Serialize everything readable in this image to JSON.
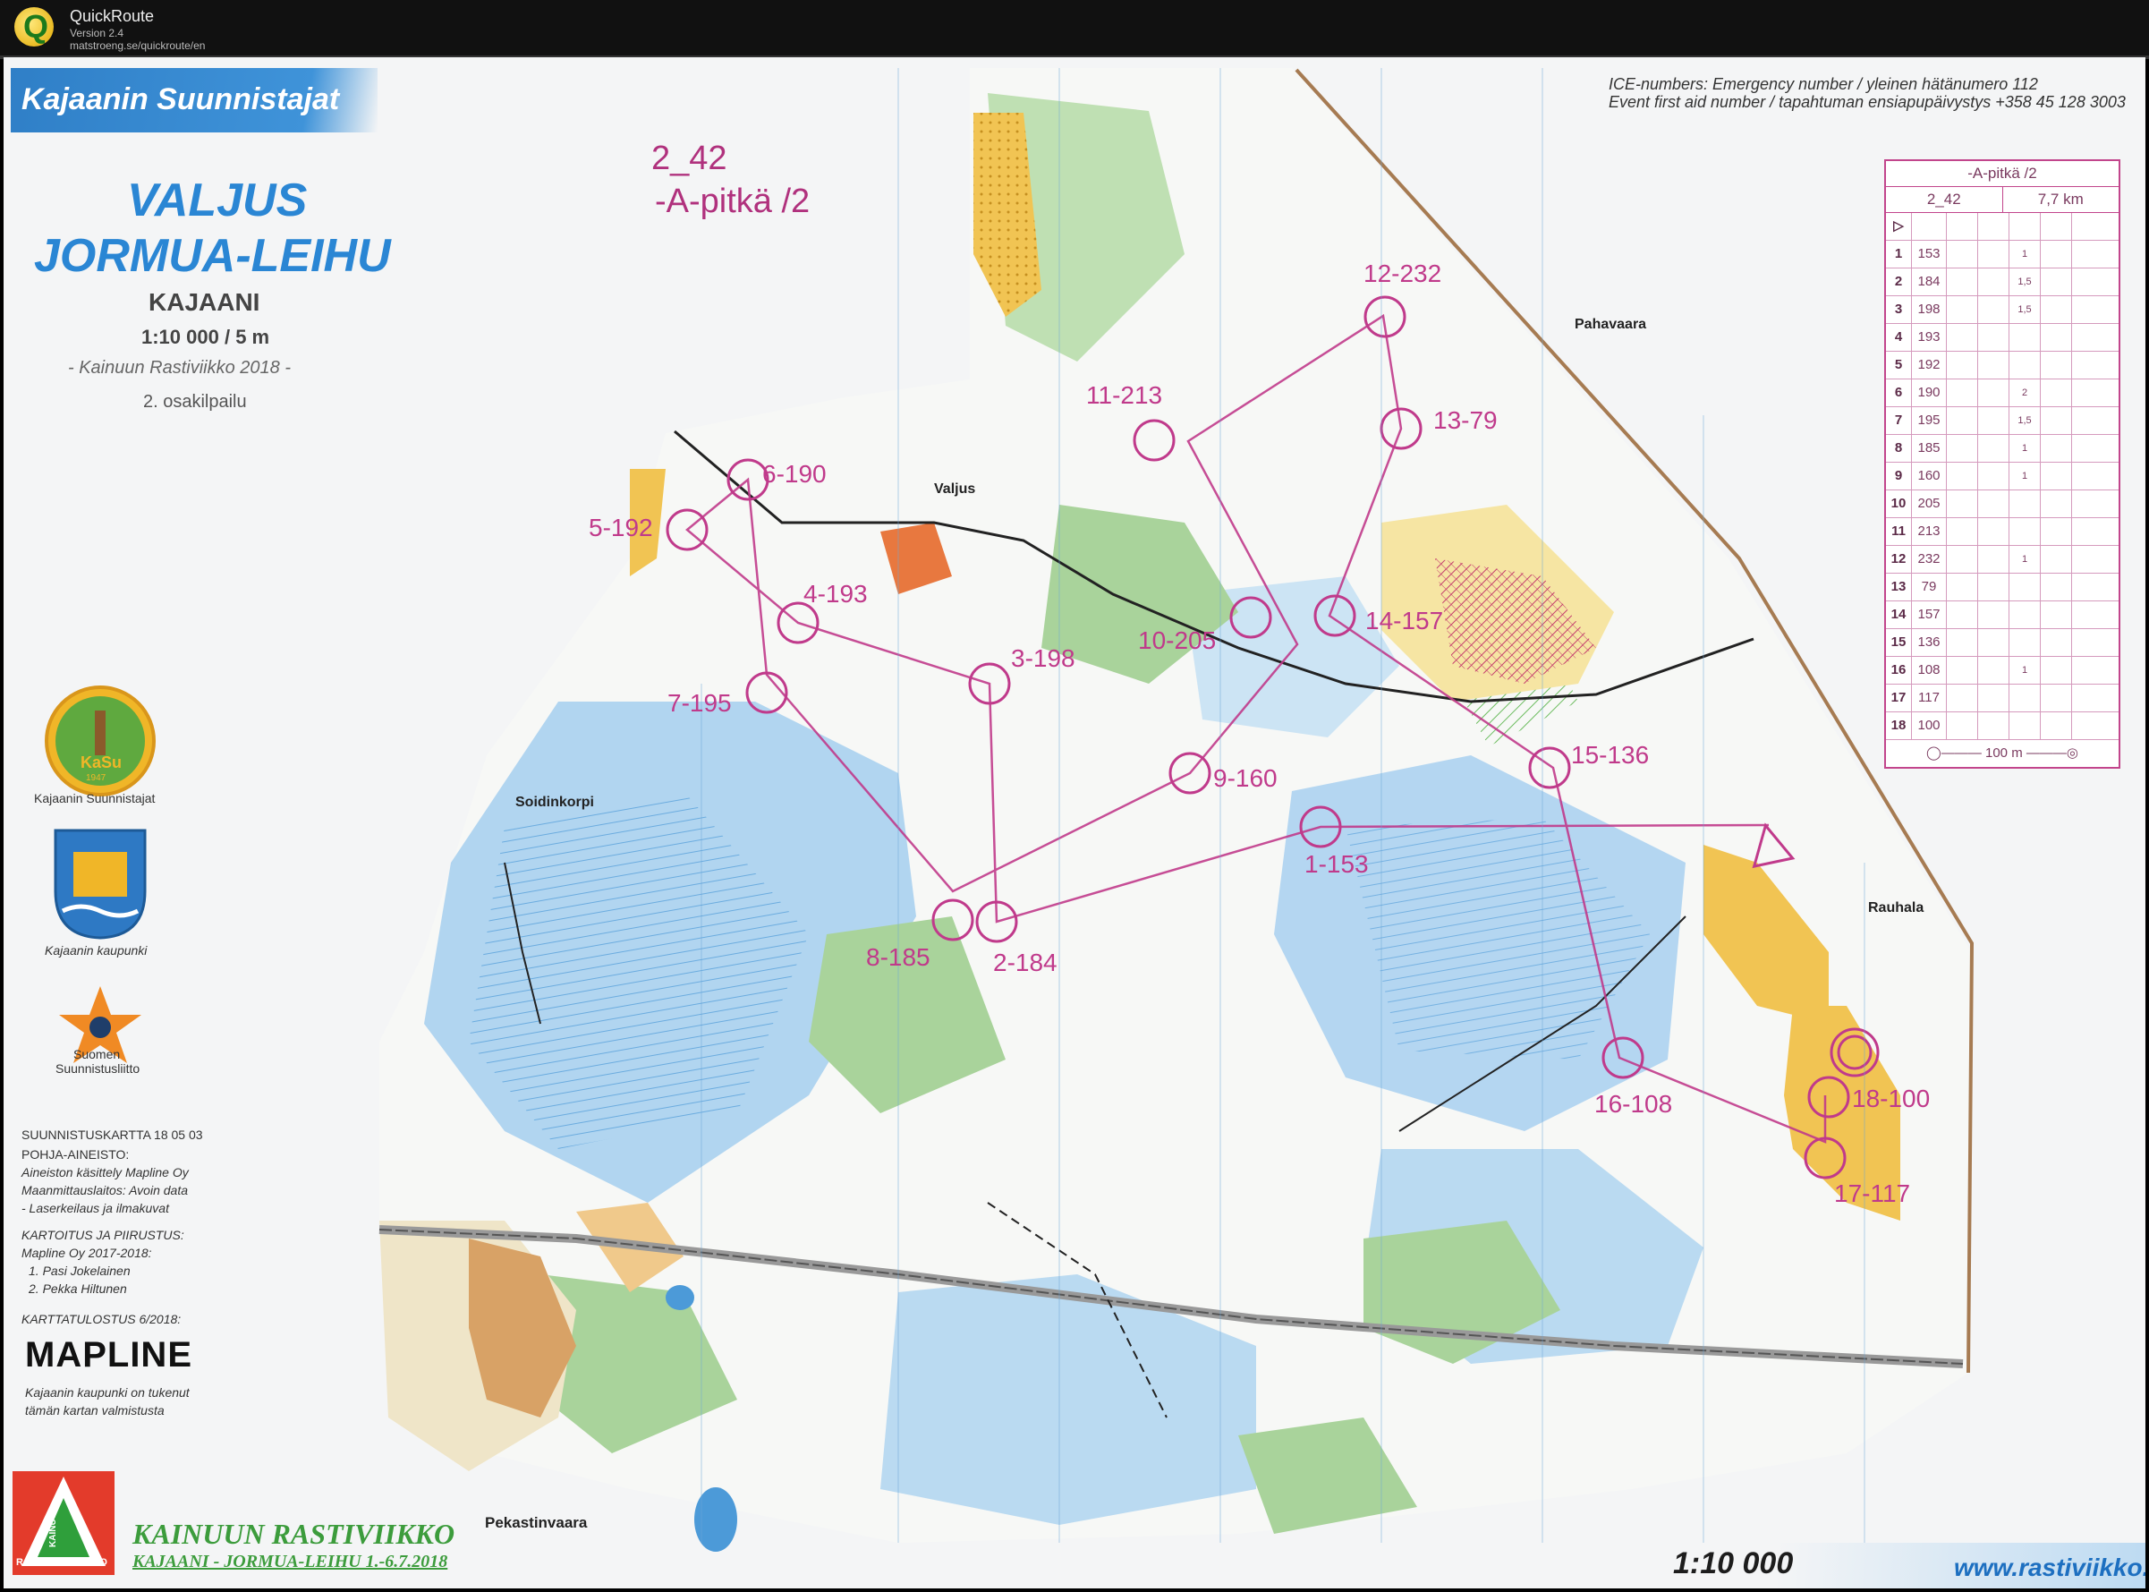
{
  "app": {
    "title": "QuickRoute",
    "version": "Version 2.4",
    "url": "matstroeng.se/quickroute/en"
  },
  "header": {
    "club": "Kajaanin Suunnistajat",
    "event_line1": "VALJUS",
    "event_line2": "JORMUA-LEIHU",
    "city": "KAJAANI",
    "scale": "1:10 000 / 5 m",
    "series": "- Kainuun Rastiviikko 2018 -",
    "stage": "2. osakilpailu"
  },
  "course": {
    "code": "2_42",
    "name": "-A-pitkä /2"
  },
  "ice": {
    "line1": "ICE-numbers: Emergency number / yleinen hätänumero 112",
    "line2": "Event first aid number / tapahtuman ensiapupäivystys +358 45 128 3003"
  },
  "control_labels": [
    "1-153",
    "2-184",
    "3-198",
    "4-193",
    "5-192",
    "6-190",
    "7-195",
    "8-185",
    "9-160",
    "10-205",
    "11-213",
    "12-232",
    "13-79",
    "14-157",
    "15-136",
    "16-108",
    "17-117",
    "18-100"
  ],
  "place_names": {
    "pahavaara": "Pahavaara",
    "valjus": "Valjus",
    "soidinkorpi": "Soidinkorpi",
    "rauhala": "Rauhala",
    "pekastinvaara": "Pekastinvaara"
  },
  "sponsors": {
    "kasu_badge": "KaSu",
    "kasu_year": "1947",
    "kasu_caption": "Kajaanin Suunnistajat",
    "city_caption": "Kajaanin kaupunki",
    "ssl_caption1": "Suomen",
    "ssl_caption2": "Suunnistusliitto"
  },
  "credits": {
    "map_id": "SUUNNISTUSKARTTA  18 05 03",
    "base_head": "POHJA-AINEISTO:",
    "base1": "Aineiston käsittely Mapline Oy",
    "base2": "Maanmittauslaitos: Avoin data",
    "base3": "- Laserkeilaus ja ilmakuvat",
    "survey_head": "KARTOITUS JA PIIRUSTUS:",
    "survey1": "Mapline Oy 2017-2018:",
    "survey2": "1. Pasi Jokelainen",
    "survey3": "2. Pekka Hiltunen",
    "print": "KARTTATULOSTUS 6/2018:",
    "mapline": "MAPLINE",
    "support1": "Kajaanin kaupunki on tukenut",
    "support2": "tämän kartan valmistusta"
  },
  "footer": {
    "event1": "KAINUUN RASTIVIIKKO",
    "event2": "KAJAANI - JORMUA-LEIHU 1.-6.7.2018",
    "rasti": "RASTI",
    "viikko": "VIIKKO",
    "kainuu": "KAINUU",
    "scale": "1:10 000",
    "url": "www.rastiviikko.fi"
  },
  "description": {
    "title": "-A-pitkä /2",
    "code": "2_42",
    "length": "7,7 km",
    "rows": [
      {
        "n": "1",
        "code": "153",
        "size": "1"
      },
      {
        "n": "2",
        "code": "184",
        "size": "1,5"
      },
      {
        "n": "3",
        "code": "198",
        "size": "1,5"
      },
      {
        "n": "4",
        "code": "193",
        "size": ""
      },
      {
        "n": "5",
        "code": "192",
        "size": ""
      },
      {
        "n": "6",
        "code": "190",
        "size": "2"
      },
      {
        "n": "7",
        "code": "195",
        "size": "1,5"
      },
      {
        "n": "8",
        "code": "185",
        "size": "1"
      },
      {
        "n": "9",
        "code": "160",
        "size": "1"
      },
      {
        "n": "10",
        "code": "205",
        "size": ""
      },
      {
        "n": "11",
        "code": "213",
        "size": ""
      },
      {
        "n": "12",
        "code": "232",
        "size": "1"
      },
      {
        "n": "13",
        "code": "79",
        "size": ""
      },
      {
        "n": "14",
        "code": "157",
        "size": ""
      },
      {
        "n": "15",
        "code": "136",
        "size": ""
      },
      {
        "n": "16",
        "code": "108",
        "size": "1"
      },
      {
        "n": "17",
        "code": "117",
        "size": ""
      },
      {
        "n": "18",
        "code": "100",
        "size": ""
      }
    ],
    "finish": "100 m"
  },
  "colors": {
    "course": "#c03a8b",
    "header_blue": "#3f93d9",
    "marsh_blue": "#8fc3ea",
    "forest_green": "#a9d39b",
    "open_yellow": "#f1c453"
  }
}
